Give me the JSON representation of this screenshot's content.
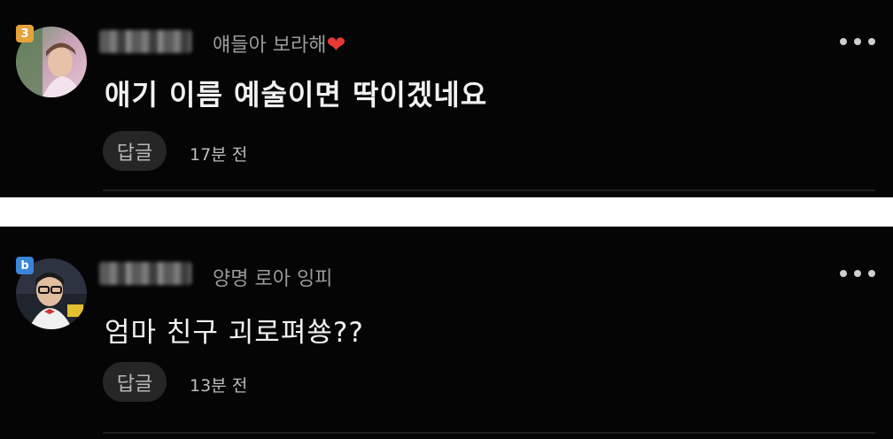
{
  "comments": [
    {
      "badge": "3",
      "subtitle": "얘들아 보라해",
      "heart": "❤",
      "text": "애기 이름 예술이면 딱이겠네요",
      "reply_label": "답글",
      "time": "17분 전"
    },
    {
      "badge": "b",
      "subtitle": "양명 로아 잉피",
      "text": "엄마 친구 괴로펴쑝??",
      "reply_label": "답글",
      "time": "13분 전"
    }
  ],
  "colors": {
    "background": "#050505",
    "separator": "#ffffff",
    "reply_button_bg": "#262626",
    "heart": "#e53935"
  },
  "icons": [
    "more-icon",
    "heart-icon"
  ]
}
